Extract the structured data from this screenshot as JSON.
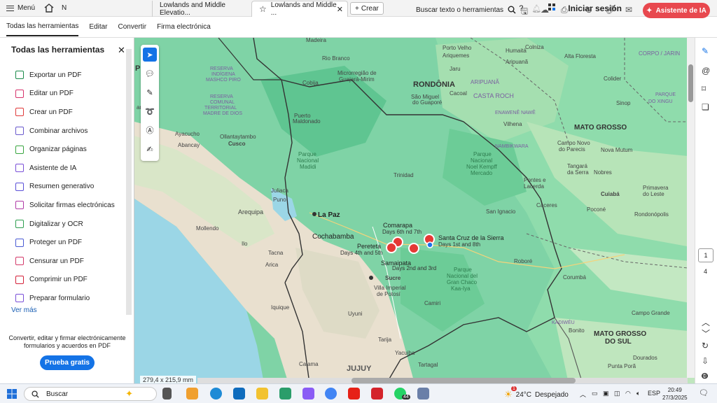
{
  "titlebar": {
    "menu_label": "Menú",
    "home_letter": "N",
    "tabs": [
      {
        "label": "Lowlands and Middle Elevatio..."
      },
      {
        "label": "Lowlands and Middle ..."
      }
    ],
    "new_tab_label": "Crear",
    "signin_label": "Iniciar sesión"
  },
  "toolbar": {
    "items": [
      "Todas las herramientas",
      "Editar",
      "Convertir",
      "Firma electrónica"
    ],
    "search_label": "Buscar texto o herramientas",
    "ai_label": "Asistente de IA"
  },
  "panel": {
    "title": "Todas las herramientas",
    "tools": [
      {
        "label": "Exportar un PDF",
        "color": "#1a8a4a"
      },
      {
        "label": "Editar un PDF",
        "color": "#d6336c"
      },
      {
        "label": "Crear un PDF",
        "color": "#e03a3a"
      },
      {
        "label": "Combinar archivos",
        "color": "#6a5acd"
      },
      {
        "label": "Organizar páginas",
        "color": "#3aa641"
      },
      {
        "label": "Asistente de IA",
        "color": "#7a4fd8"
      },
      {
        "label": "Resumen generativo",
        "color": "#5a50d8"
      },
      {
        "label": "Solicitar firmas electrónicas",
        "color": "#b03aa6"
      },
      {
        "label": "Digitalizar y OCR",
        "color": "#2e9e4f"
      },
      {
        "label": "Proteger un PDF",
        "color": "#4a5bd4"
      },
      {
        "label": "Censurar un PDF",
        "color": "#d43a6a"
      },
      {
        "label": "Comprimir un PDF",
        "color": "#d4223a"
      },
      {
        "label": "Preparar formulario",
        "color": "#7a4fd8"
      }
    ],
    "ver_mas": "Ver más",
    "promo": "Convertir, editar y firmar electrónicamente formularios y acuerdos en PDF",
    "trial_label": "Prueba gratis"
  },
  "document": {
    "page_size": "279,4 x 215,9 mm",
    "current_page": "1",
    "total_pages": "4"
  },
  "map": {
    "places": {
      "madeira": "Madeira",
      "rio_branco": "Rio Branco",
      "porto_velho": "Porto Velho",
      "humaita": "Humaitá",
      "ji_parana": "Ji-Paraná",
      "ariquemes": "Ariquemes",
      "jaru": "Jaru",
      "aripuana": "ARIPUANÃ",
      "aripuana2": "Aripuanã",
      "colniza": "Colniza",
      "alta_floresta": "Alta Floresta",
      "corpo_jarin": "CORPO / JARIN",
      "rondonia": "RONDÔNIA",
      "reserva": "RESERVA\nINDÍGENA\nMASHCO PIRO",
      "microrregiao": "Microrregião de\nGuajará-Mirim",
      "cobija": "Cobija",
      "sao_miguel": "São Miguel\ndo Guaporé",
      "cacoal": "Cacoal",
      "rio_branco2": "Rio Branco",
      "reserva_com": "RESERVA\nCOMUNAL\nTERRITORIAL\nMADRE DE DIOS",
      "puerto_maldonado": "Puerto\nMaldonado",
      "enawene": "ENAWENÊ NAWÊ",
      "vilhena": "Vilhena",
      "colider": "Colider",
      "sinop": "Sinop",
      "parque_xingu": "PARQUE\nDO XINGU",
      "mato_grosso": "MATO GROSSO",
      "cuzco": "Cusco",
      "ayacucho": "Ayacucho",
      "olla": "Ollantaytambo",
      "abancay": "Abancay",
      "nambikwara": "NAMBIKWARA",
      "campo_novo": "Campo Novo\ndo Parecis",
      "nova_mutum": "Nova Mutum",
      "parque_madidi": "Parque\nNacional\nMadidi",
      "trinidad": "Trinidad",
      "parque_noel": "Parque\nNacional\nNoel Kempff\nMercado",
      "tangara": "Tangará\nda Serra",
      "nobres": "Nobres",
      "pontes": "Pontes e\nLacerda",
      "cuiaba": "Cuiabá",
      "primavera": "Primavera\ndo Leste",
      "juliaca": "Juliaca",
      "puno": "Puno",
      "la_paz": "La Paz",
      "arequipa": "Arequipa",
      "san_ignacio": "San Ignacio",
      "caceres": "Cáceres",
      "pocone": "Poconé",
      "rondonopolis": "Rondonópolis",
      "mollendo": "Mollendo",
      "ilo": "Ilo",
      "cochabamba": "Cochabamba",
      "comarapa": "Comarapa",
      "comarapa_days": "Days 6th nd 7th",
      "santa_cruz": "Santa Cruz de la Sierra",
      "santa_cruz_days": "Days 1st and 8th",
      "pereteta": "Pereteta",
      "pereteta_days": "Days 4th and 5th",
      "samaipata": "Samaipata",
      "samaipata_days": "Days 2nd and 3rd",
      "tacna": "Tacna",
      "arica": "Arica",
      "robore": "Roboré",
      "sucre": "Sucre",
      "villa_imperial": "Villa Imperial\nde Potosí",
      "parque_chaco": "Parque\nNacional del\nGran Chaco\nKaa-Iya",
      "corumba": "Corumbá",
      "iquique": "Iquique",
      "uyuni": "Uyuni",
      "camiri": "Camiri",
      "campo_grande": "Campo Grande",
      "kadiweu": "KADIWÉU",
      "bonito": "Bonito",
      "mato_grosso_sul": "MATO GROSSO\nDO SUL",
      "tarija": "Tarija",
      "yacuiba": "Yacuiba",
      "tartagal": "Tartagal",
      "calama": "Calama",
      "jujuy": "JUJUY",
      "dourados": "Dourados",
      "ponta_pora": "Punta Porã",
      "ancayo": "ancayo",
      "p_edge": "P"
    }
  },
  "taskbar": {
    "search_placeholder": "Buscar",
    "weather_temp": "24°C",
    "weather_desc": "Despejado",
    "lang": "ESP",
    "time": "20:49",
    "date": "27/3/2025",
    "whatsapp_badge": "44",
    "weather_badge": "1"
  }
}
